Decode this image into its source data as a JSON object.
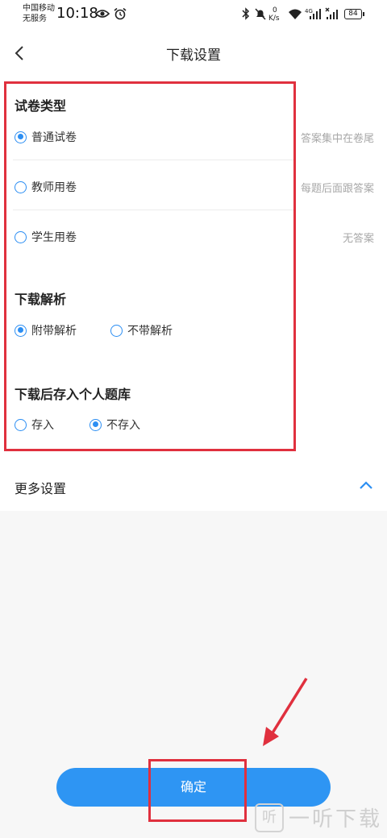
{
  "status_bar": {
    "carrier_line1": "中国移动",
    "carrier_line2": "无服务",
    "time": "10:18",
    "speed_value": "0",
    "speed_unit": "K/s",
    "network": "4G",
    "battery": "84"
  },
  "header": {
    "title": "下载设置"
  },
  "paper_type": {
    "title": "试卷类型",
    "options": [
      {
        "label": "普通试卷",
        "desc": "答案集中在卷尾",
        "checked": true
      },
      {
        "label": "教师用卷",
        "desc": "每题后面跟答案",
        "checked": false
      },
      {
        "label": "学生用卷",
        "desc": "无答案",
        "checked": false
      }
    ]
  },
  "download_analysis": {
    "title": "下载解析",
    "options": [
      {
        "label": "附带解析",
        "checked": true
      },
      {
        "label": "不带解析",
        "checked": false
      }
    ]
  },
  "save_to_bank": {
    "title": "下载后存入个人题库",
    "options": [
      {
        "label": "存入",
        "checked": false
      },
      {
        "label": "不存入",
        "checked": true
      }
    ]
  },
  "more_settings": {
    "label": "更多设置"
  },
  "confirm_button": {
    "label": "确定"
  },
  "watermark": {
    "logo": "听",
    "text": "一听下载"
  },
  "colors": {
    "accent": "#2e95f3",
    "annotation": "#e0303e"
  }
}
